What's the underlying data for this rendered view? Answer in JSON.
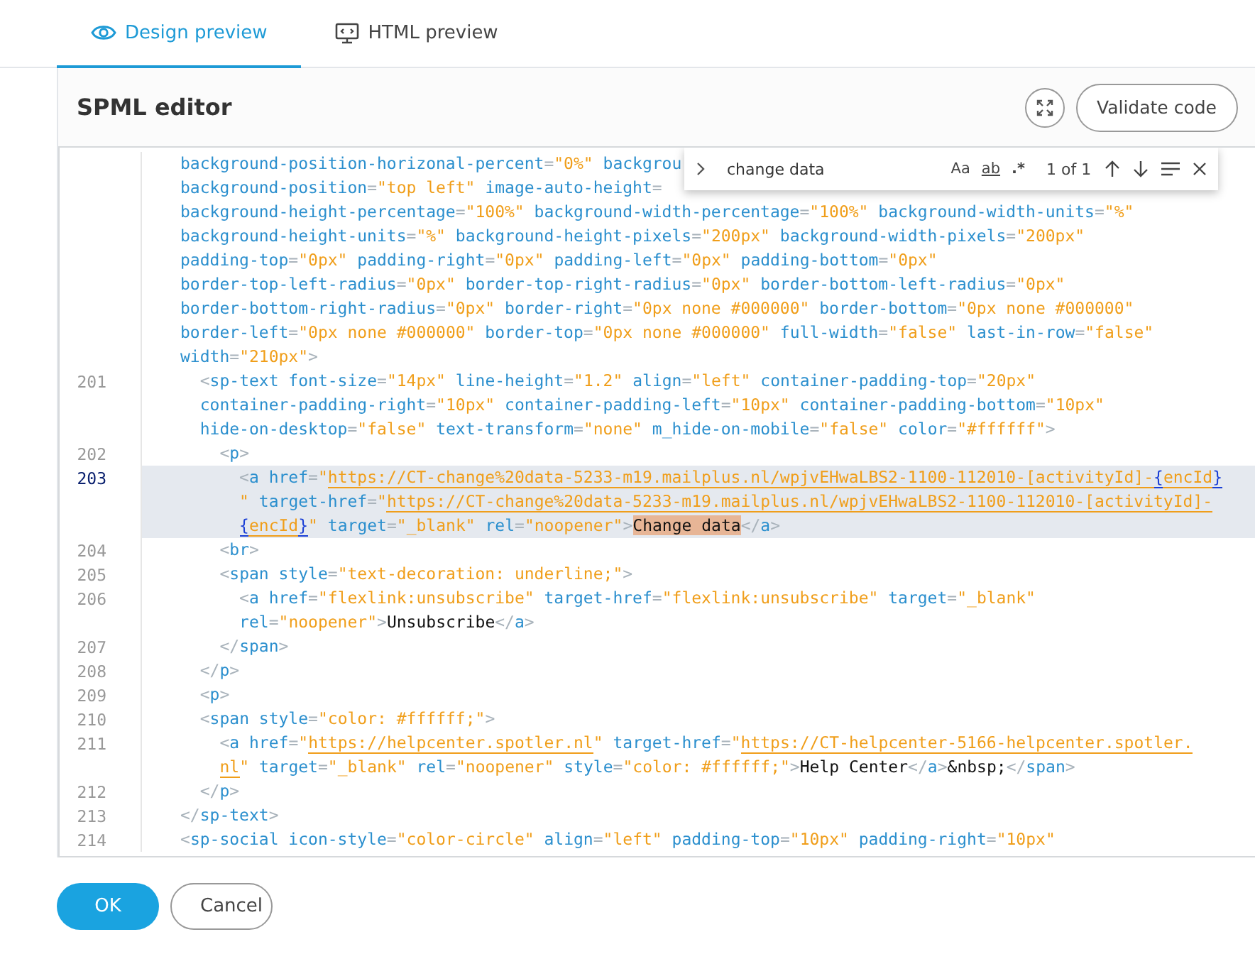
{
  "tabs": [
    {
      "label": "Design preview",
      "selected": true
    },
    {
      "label": "HTML preview",
      "selected": false
    }
  ],
  "editor": {
    "title": "SPML editor",
    "validate_button": "Validate code",
    "lines": [
      {
        "selected": false,
        "tokens": [
          {
            "kind": "name",
            "text": "background-position-horizonal-percent"
          },
          {
            "kind": "punct",
            "text": "="
          },
          {
            "kind": "value",
            "text": "\"0%\""
          },
          {
            "kind": "name",
            "text": " backgrou"
          }
        ]
      },
      {
        "selected": false,
        "tokens": [
          {
            "kind": "name",
            "text": "background-position"
          },
          {
            "kind": "punct",
            "text": "="
          },
          {
            "kind": "value",
            "text": "\"top left\""
          },
          {
            "kind": "name",
            "text": " image-auto-height"
          },
          {
            "kind": "punct",
            "text": "="
          }
        ]
      },
      {
        "selected": false,
        "tokens": [
          {
            "kind": "name",
            "text": "background-height-percentage"
          },
          {
            "kind": "punct",
            "text": "="
          },
          {
            "kind": "value",
            "text": "\"100%\""
          },
          {
            "kind": "name",
            "text": " background-width-percentage"
          },
          {
            "kind": "punct",
            "text": "="
          },
          {
            "kind": "value",
            "text": "\"100%\""
          },
          {
            "kind": "name",
            "text": " background-width-units"
          },
          {
            "kind": "punct",
            "text": "="
          },
          {
            "kind": "value",
            "text": "\"%\""
          }
        ]
      },
      {
        "selected": false,
        "tokens": [
          {
            "kind": "name",
            "text": "background-height-units"
          },
          {
            "kind": "punct",
            "text": "="
          },
          {
            "kind": "value",
            "text": "\"%\""
          },
          {
            "kind": "name",
            "text": " background-height-pixels"
          },
          {
            "kind": "punct",
            "text": "="
          },
          {
            "kind": "value",
            "text": "\"200px\""
          },
          {
            "kind": "name",
            "text": " background-width-pixels"
          },
          {
            "kind": "punct",
            "text": "="
          },
          {
            "kind": "value",
            "text": "\"200px\""
          }
        ]
      },
      {
        "selected": false,
        "tokens": [
          {
            "kind": "name",
            "text": "padding-top"
          },
          {
            "kind": "punct",
            "text": "="
          },
          {
            "kind": "value",
            "text": "\"0px\""
          },
          {
            "kind": "name",
            "text": " padding-right"
          },
          {
            "kind": "punct",
            "text": "="
          },
          {
            "kind": "value",
            "text": "\"0px\""
          },
          {
            "kind": "name",
            "text": " padding-left"
          },
          {
            "kind": "punct",
            "text": "="
          },
          {
            "kind": "value",
            "text": "\"0px\""
          },
          {
            "kind": "name",
            "text": " padding-bottom"
          },
          {
            "kind": "punct",
            "text": "="
          },
          {
            "kind": "value",
            "text": "\"0px\""
          }
        ]
      },
      {
        "selected": false,
        "tokens": [
          {
            "kind": "name",
            "text": "border-top-left-radius"
          },
          {
            "kind": "punct",
            "text": "="
          },
          {
            "kind": "value",
            "text": "\"0px\""
          },
          {
            "kind": "name",
            "text": " border-top-right-radius"
          },
          {
            "kind": "punct",
            "text": "="
          },
          {
            "kind": "value",
            "text": "\"0px\""
          },
          {
            "kind": "name",
            "text": " border-bottom-left-radius"
          },
          {
            "kind": "punct",
            "text": "="
          },
          {
            "kind": "value",
            "text": "\"0px\""
          }
        ]
      },
      {
        "selected": false,
        "tokens": [
          {
            "kind": "name",
            "text": "border-bottom-right-radius"
          },
          {
            "kind": "punct",
            "text": "="
          },
          {
            "kind": "value",
            "text": "\"0px\""
          },
          {
            "kind": "name",
            "text": " border-right"
          },
          {
            "kind": "punct",
            "text": "="
          },
          {
            "kind": "value",
            "text": "\"0px none #000000\""
          },
          {
            "kind": "name",
            "text": " border-bottom"
          },
          {
            "kind": "punct",
            "text": "="
          },
          {
            "kind": "value",
            "text": "\"0px none #000000\""
          }
        ]
      },
      {
        "selected": false,
        "tokens": [
          {
            "kind": "name",
            "text": "border-left"
          },
          {
            "kind": "punct",
            "text": "="
          },
          {
            "kind": "value",
            "text": "\"0px none #000000\""
          },
          {
            "kind": "name",
            "text": " border-top"
          },
          {
            "kind": "punct",
            "text": "="
          },
          {
            "kind": "value",
            "text": "\"0px none #000000\""
          },
          {
            "kind": "name",
            "text": " full-width"
          },
          {
            "kind": "punct",
            "text": "="
          },
          {
            "kind": "value",
            "text": "\"false\""
          },
          {
            "kind": "name",
            "text": " last-in-row"
          },
          {
            "kind": "punct",
            "text": "="
          },
          {
            "kind": "value",
            "text": "\"false\""
          }
        ]
      },
      {
        "selected": false,
        "tokens": [
          {
            "kind": "name",
            "text": "width"
          },
          {
            "kind": "punct",
            "text": "="
          },
          {
            "kind": "value",
            "text": "\"210px\""
          },
          {
            "kind": "punct",
            "text": ">"
          }
        ]
      },
      {
        "number": "201",
        "selected": false,
        "tokens": [
          {
            "kind": "punct",
            "text": "  <"
          },
          {
            "kind": "name",
            "text": "sp-text font-size"
          },
          {
            "kind": "punct",
            "text": "="
          },
          {
            "kind": "value",
            "text": "\"14px\""
          },
          {
            "kind": "name",
            "text": " line-height"
          },
          {
            "kind": "punct",
            "text": "="
          },
          {
            "kind": "value",
            "text": "\"1.2\""
          },
          {
            "kind": "name",
            "text": " align"
          },
          {
            "kind": "punct",
            "text": "="
          },
          {
            "kind": "value",
            "text": "\"left\""
          },
          {
            "kind": "name",
            "text": " container-padding-top"
          },
          {
            "kind": "punct",
            "text": "="
          },
          {
            "kind": "value",
            "text": "\"20px\""
          }
        ]
      },
      {
        "selected": false,
        "tokens": [
          {
            "kind": "name",
            "text": "  container-padding-right"
          },
          {
            "kind": "punct",
            "text": "="
          },
          {
            "kind": "value",
            "text": "\"10px\""
          },
          {
            "kind": "name",
            "text": " container-padding-left"
          },
          {
            "kind": "punct",
            "text": "="
          },
          {
            "kind": "value",
            "text": "\"10px\""
          },
          {
            "kind": "name",
            "text": " container-padding-bottom"
          },
          {
            "kind": "punct",
            "text": "="
          },
          {
            "kind": "value",
            "text": "\"10px\""
          }
        ]
      },
      {
        "selected": false,
        "tokens": [
          {
            "kind": "name",
            "text": "  hide-on-desktop"
          },
          {
            "kind": "punct",
            "text": "="
          },
          {
            "kind": "value",
            "text": "\"false\""
          },
          {
            "kind": "name",
            "text": " text-transform"
          },
          {
            "kind": "punct",
            "text": "="
          },
          {
            "kind": "value",
            "text": "\"none\""
          },
          {
            "kind": "name",
            "text": " m_hide-on-mobile"
          },
          {
            "kind": "punct",
            "text": "="
          },
          {
            "kind": "value",
            "text": "\"false\""
          },
          {
            "kind": "name",
            "text": " color"
          },
          {
            "kind": "punct",
            "text": "="
          },
          {
            "kind": "value",
            "text": "\"#ffffff\""
          },
          {
            "kind": "punct",
            "text": ">"
          }
        ]
      },
      {
        "number": "202",
        "selected": false,
        "tokens": [
          {
            "kind": "punct",
            "text": "    <"
          },
          {
            "kind": "name",
            "text": "p"
          },
          {
            "kind": "punct",
            "text": ">"
          }
        ]
      },
      {
        "number": "203",
        "selected": true,
        "tokens": [
          {
            "kind": "punct",
            "text": "      <"
          },
          {
            "kind": "name",
            "text": "a href"
          },
          {
            "kind": "punct",
            "text": "="
          },
          {
            "kind": "value",
            "text": "\""
          },
          {
            "kind": "link",
            "text": "https://CT-change%20data-5233-m19.mailplus.nl/wpjvEHwaLBS2-1100-112010-[activityId]-"
          },
          {
            "kind": "brace",
            "text": "{"
          },
          {
            "kind": "link",
            "text": "encId"
          },
          {
            "kind": "brace",
            "text": "}"
          }
        ]
      },
      {
        "selected": true,
        "tokens": [
          {
            "kind": "value",
            "text": "      \""
          },
          {
            "kind": "name",
            "text": " target-href"
          },
          {
            "kind": "punct",
            "text": "="
          },
          {
            "kind": "value",
            "text": "\""
          },
          {
            "kind": "link",
            "text": "https://CT-change%20data-5233-m19.mailplus.nl/wpjvEHwaLBS2-1100-112010-[activityId]-"
          }
        ]
      },
      {
        "selected": true,
        "tokens": [
          {
            "kind": "brace",
            "text": "      {"
          },
          {
            "kind": "link",
            "text": "encId"
          },
          {
            "kind": "brace",
            "text": "}"
          },
          {
            "kind": "value",
            "text": "\""
          },
          {
            "kind": "name",
            "text": " target"
          },
          {
            "kind": "punct",
            "text": "="
          },
          {
            "kind": "value",
            "text": "\"_blank\""
          },
          {
            "kind": "name",
            "text": " rel"
          },
          {
            "kind": "punct",
            "text": "="
          },
          {
            "kind": "value",
            "text": "\"noopener\""
          },
          {
            "kind": "punct",
            "text": ">"
          },
          {
            "kind": "match",
            "text": "Change data"
          },
          {
            "kind": "punct",
            "text": "</"
          },
          {
            "kind": "name",
            "text": "a"
          },
          {
            "kind": "punct",
            "text": ">"
          }
        ]
      },
      {
        "number": "204",
        "selected": false,
        "tokens": [
          {
            "kind": "punct",
            "text": "    <"
          },
          {
            "kind": "name",
            "text": "br"
          },
          {
            "kind": "punct",
            "text": ">"
          }
        ]
      },
      {
        "number": "205",
        "selected": false,
        "tokens": [
          {
            "kind": "punct",
            "text": "    <"
          },
          {
            "kind": "name",
            "text": "span style"
          },
          {
            "kind": "punct",
            "text": "="
          },
          {
            "kind": "value",
            "text": "\"text-decoration: underline;\""
          },
          {
            "kind": "punct",
            "text": ">"
          }
        ]
      },
      {
        "number": "206",
        "selected": false,
        "tokens": [
          {
            "kind": "punct",
            "text": "      <"
          },
          {
            "kind": "name",
            "text": "a href"
          },
          {
            "kind": "punct",
            "text": "="
          },
          {
            "kind": "value",
            "text": "\"flexlink:unsubscribe\""
          },
          {
            "kind": "name",
            "text": " target-href"
          },
          {
            "kind": "punct",
            "text": "="
          },
          {
            "kind": "value",
            "text": "\"flexlink:unsubscribe\""
          },
          {
            "kind": "name",
            "text": " target"
          },
          {
            "kind": "punct",
            "text": "="
          },
          {
            "kind": "value",
            "text": "\"_blank\""
          }
        ]
      },
      {
        "selected": false,
        "tokens": [
          {
            "kind": "name",
            "text": "      rel"
          },
          {
            "kind": "punct",
            "text": "="
          },
          {
            "kind": "value",
            "text": "\"noopener\""
          },
          {
            "kind": "punct",
            "text": ">"
          },
          {
            "kind": "text",
            "text": "Unsubscribe"
          },
          {
            "kind": "punct",
            "text": "</"
          },
          {
            "kind": "name",
            "text": "a"
          },
          {
            "kind": "punct",
            "text": ">"
          }
        ]
      },
      {
        "number": "207",
        "selected": false,
        "tokens": [
          {
            "kind": "punct",
            "text": "    </"
          },
          {
            "kind": "name",
            "text": "span"
          },
          {
            "kind": "punct",
            "text": ">"
          }
        ]
      },
      {
        "number": "208",
        "selected": false,
        "tokens": [
          {
            "kind": "punct",
            "text": "  </"
          },
          {
            "kind": "name",
            "text": "p"
          },
          {
            "kind": "punct",
            "text": ">"
          }
        ]
      },
      {
        "number": "209",
        "selected": false,
        "tokens": [
          {
            "kind": "punct",
            "text": "  <"
          },
          {
            "kind": "name",
            "text": "p"
          },
          {
            "kind": "punct",
            "text": ">"
          }
        ]
      },
      {
        "number": "210",
        "selected": false,
        "tokens": [
          {
            "kind": "punct",
            "text": "  <"
          },
          {
            "kind": "name",
            "text": "span style"
          },
          {
            "kind": "punct",
            "text": "="
          },
          {
            "kind": "value",
            "text": "\"color: #ffffff;\""
          },
          {
            "kind": "punct",
            "text": ">"
          }
        ]
      },
      {
        "number": "211",
        "selected": false,
        "tokens": [
          {
            "kind": "punct",
            "text": "    <"
          },
          {
            "kind": "name",
            "text": "a href"
          },
          {
            "kind": "punct",
            "text": "="
          },
          {
            "kind": "value",
            "text": "\""
          },
          {
            "kind": "link",
            "text": "https://helpcenter.spotler.nl"
          },
          {
            "kind": "value",
            "text": "\""
          },
          {
            "kind": "name",
            "text": " target-href"
          },
          {
            "kind": "punct",
            "text": "="
          },
          {
            "kind": "value",
            "text": "\""
          },
          {
            "kind": "link",
            "text": "https://CT-helpcenter-5166-helpcenter.spotler."
          }
        ]
      },
      {
        "selected": false,
        "tokens": [
          {
            "kind": "link",
            "text": "    nl"
          },
          {
            "kind": "value",
            "text": "\""
          },
          {
            "kind": "name",
            "text": " target"
          },
          {
            "kind": "punct",
            "text": "="
          },
          {
            "kind": "value",
            "text": "\"_blank\""
          },
          {
            "kind": "name",
            "text": " rel"
          },
          {
            "kind": "punct",
            "text": "="
          },
          {
            "kind": "value",
            "text": "\"noopener\""
          },
          {
            "kind": "name",
            "text": " style"
          },
          {
            "kind": "punct",
            "text": "="
          },
          {
            "kind": "value",
            "text": "\"color: #ffffff;\""
          },
          {
            "kind": "punct",
            "text": ">"
          },
          {
            "kind": "text",
            "text": "Help Center"
          },
          {
            "kind": "punct",
            "text": "</"
          },
          {
            "kind": "name",
            "text": "a"
          },
          {
            "kind": "punct",
            "text": ">"
          },
          {
            "kind": "text",
            "text": "&nbsp;"
          },
          {
            "kind": "punct",
            "text": "</"
          },
          {
            "kind": "name",
            "text": "span"
          },
          {
            "kind": "punct",
            "text": ">"
          }
        ]
      },
      {
        "number": "212",
        "selected": false,
        "tokens": [
          {
            "kind": "punct",
            "text": "  </"
          },
          {
            "kind": "name",
            "text": "p"
          },
          {
            "kind": "punct",
            "text": ">"
          }
        ]
      },
      {
        "number": "213",
        "selected": false,
        "tokens": [
          {
            "kind": "punct",
            "text": "</"
          },
          {
            "kind": "name",
            "text": "sp-text"
          },
          {
            "kind": "punct",
            "text": ">"
          }
        ]
      },
      {
        "number": "214",
        "selected": false,
        "tokens": [
          {
            "kind": "punct",
            "text": "<"
          },
          {
            "kind": "name",
            "text": "sp-social icon-style"
          },
          {
            "kind": "punct",
            "text": "="
          },
          {
            "kind": "value",
            "text": "\"color-circle\""
          },
          {
            "kind": "name",
            "text": " align"
          },
          {
            "kind": "punct",
            "text": "="
          },
          {
            "kind": "value",
            "text": "\"left\""
          },
          {
            "kind": "name",
            "text": " padding-top"
          },
          {
            "kind": "punct",
            "text": "="
          },
          {
            "kind": "value",
            "text": "\"10px\""
          },
          {
            "kind": "name",
            "text": " padding-right"
          },
          {
            "kind": "punct",
            "text": "="
          },
          {
            "kind": "value",
            "text": "\"10px\""
          }
        ]
      }
    ],
    "find": {
      "query": "change data",
      "options": [
        "Aa",
        "ab",
        ".*"
      ],
      "result": "1 of 1"
    }
  },
  "buttons": [
    {
      "label": "OK",
      "kind": "primary"
    },
    {
      "label": "Cancel",
      "kind": "secondary"
    }
  ]
}
